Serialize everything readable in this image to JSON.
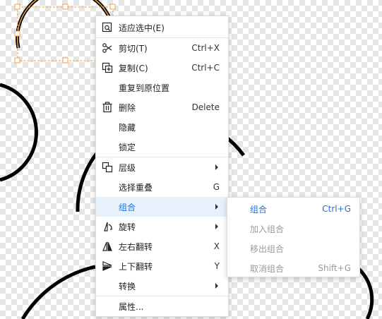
{
  "theme": {
    "accent": "#1e6fd9",
    "hover_bg": "#e6f1fb",
    "disabled_text": "#9a9a9a",
    "selection_orange": "#f0a04b",
    "pointer_red": "#e0202a"
  },
  "context_menu": {
    "items": [
      {
        "label": "适应选中(E)",
        "shortcut": "",
        "icon": "fit-selection-icon"
      },
      {
        "label": "剪切(T)",
        "shortcut": "Ctrl+X",
        "icon": "scissors-icon"
      },
      {
        "label": "复制(C)",
        "shortcut": "Ctrl+C",
        "icon": "copy-icon"
      },
      {
        "label": "重复到原位置",
        "shortcut": "",
        "icon": ""
      },
      {
        "label": "删除",
        "shortcut": "Delete",
        "icon": "trash-icon"
      },
      {
        "label": "隐藏",
        "shortcut": "",
        "icon": ""
      },
      {
        "label": "锁定",
        "shortcut": "",
        "icon": ""
      },
      {
        "label": "层级",
        "shortcut": "",
        "icon": "layers-icon"
      },
      {
        "label": "选择重叠",
        "shortcut": "G",
        "icon": ""
      },
      {
        "label": "组合",
        "shortcut": "",
        "icon": ""
      },
      {
        "label": "旋转",
        "shortcut": "",
        "icon": "rotate-icon"
      },
      {
        "label": "左右翻转",
        "shortcut": "X",
        "icon": "flip-horizontal-icon"
      },
      {
        "label": "上下翻转",
        "shortcut": "Y",
        "icon": "flip-vertical-icon"
      },
      {
        "label": "转换",
        "shortcut": "",
        "icon": ""
      },
      {
        "label": "属性...",
        "shortcut": "",
        "icon": ""
      }
    ]
  },
  "group_submenu": {
    "items": [
      {
        "label": "组合",
        "shortcut": "Ctrl+G",
        "enabled": true
      },
      {
        "label": "加入组合",
        "shortcut": "",
        "enabled": false
      },
      {
        "label": "移出组合",
        "shortcut": "",
        "enabled": false
      },
      {
        "label": "取消组合",
        "shortcut": "Shift+G",
        "enabled": false
      }
    ]
  }
}
